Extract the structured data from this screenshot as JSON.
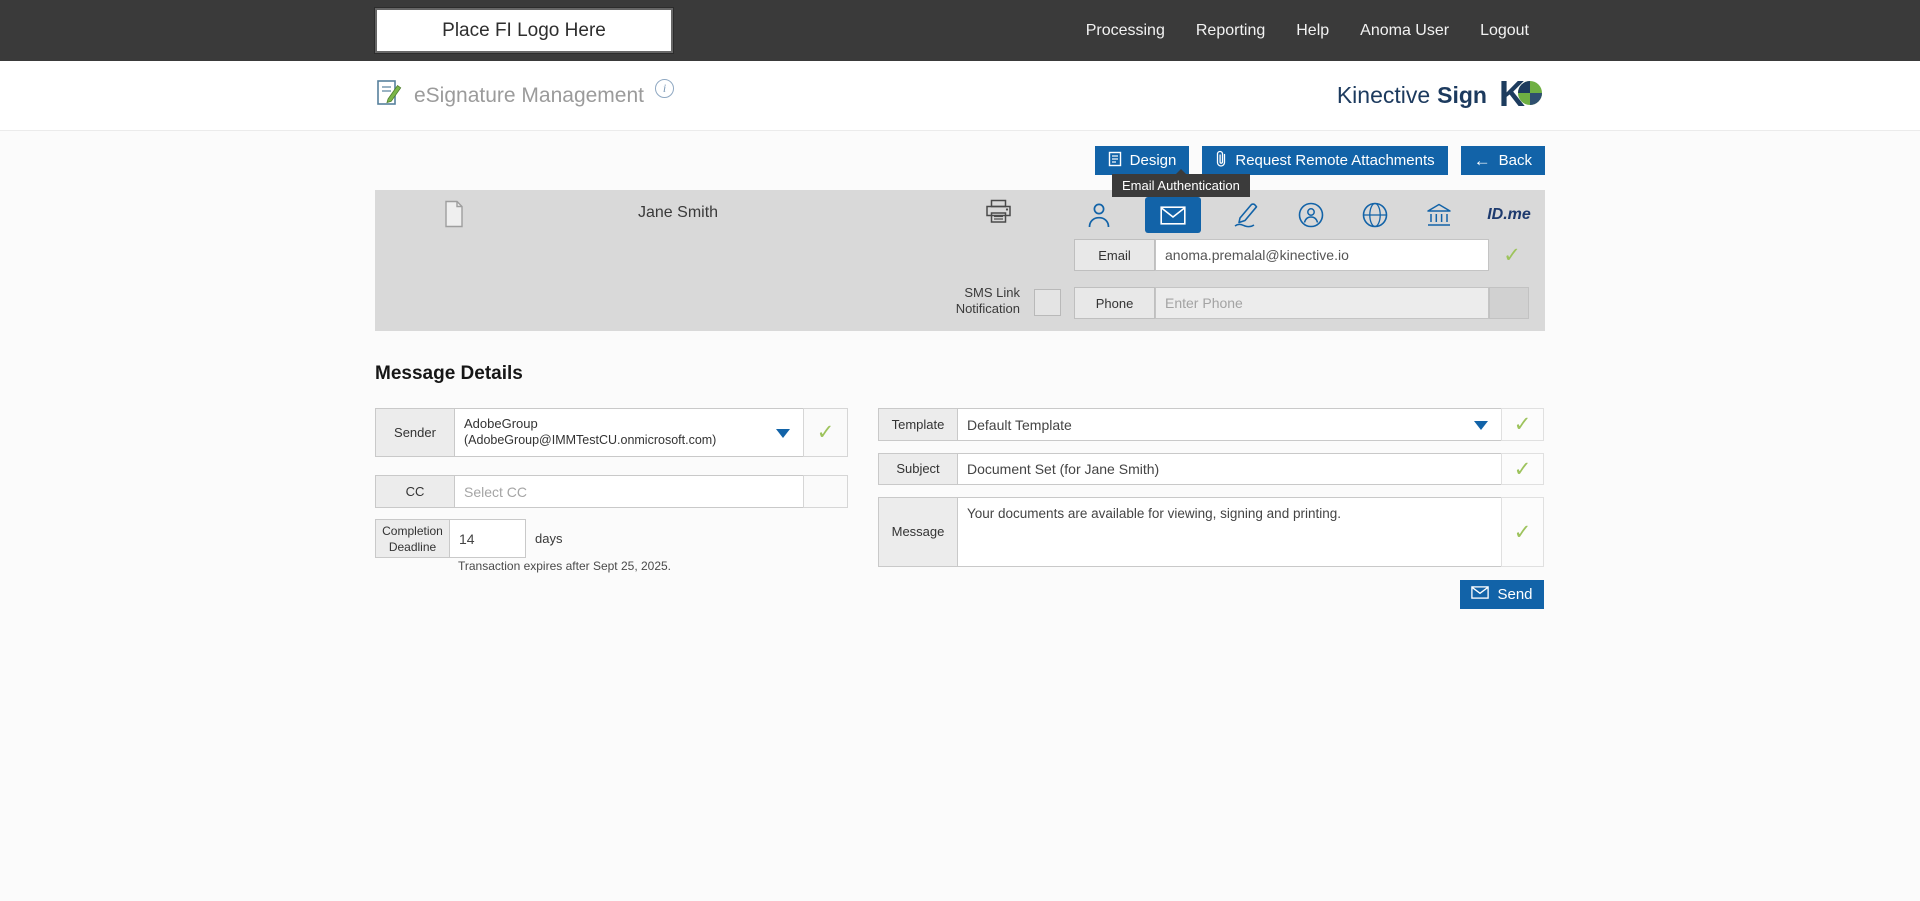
{
  "topbar": {
    "logo_placeholder": "Place FI Logo Here",
    "nav": [
      "Processing",
      "Reporting",
      "Help",
      "Anoma User",
      "Logout"
    ]
  },
  "header": {
    "title": "eSignature Management",
    "brand_name": "Kinective",
    "brand_product": "Sign"
  },
  "toolbar": {
    "design": "Design",
    "request_remote_attachments": "Request Remote Attachments",
    "back": "Back"
  },
  "tooltip": "Email Authentication",
  "recipient": {
    "name": "Jane Smith",
    "email_label": "Email",
    "email_value": "anoma.premalal@kinective.io",
    "sms_label": "SMS Link Notification",
    "phone_label": "Phone",
    "phone_placeholder": "Enter Phone",
    "idme": "ID.me",
    "auth_methods": [
      "user",
      "email",
      "signature",
      "kba",
      "web",
      "bank",
      "idme"
    ]
  },
  "message_details": {
    "heading": "Message Details",
    "sender_label": "Sender",
    "sender_line1": "AdobeGroup",
    "sender_line2": "(AdobeGroup@IMMTestCU.onmicrosoft.com)",
    "cc_label": "CC",
    "cc_placeholder": "Select CC",
    "deadline_label": "Completion Deadline",
    "deadline_value": "14",
    "deadline_unit": "days",
    "expiry_note": "Transaction expires after Sept 25, 2025.",
    "template_label": "Template",
    "template_value": "Default Template",
    "subject_label": "Subject",
    "subject_value": "Document Set (for Jane Smith)",
    "message_label": "Message",
    "message_value": "Your documents are available for viewing, signing and printing.",
    "send": "Send"
  },
  "icons": {
    "info": "i",
    "back_arrow": "←",
    "check": "✓"
  },
  "colors": {
    "accent_blue": "#1263a8",
    "check_green": "#9dc35c",
    "topbar_bg": "#3a3a3a",
    "panel_bg": "#d9d9d9",
    "brand_navy": "#1c3a5e",
    "brand_green": "#6fb043"
  }
}
